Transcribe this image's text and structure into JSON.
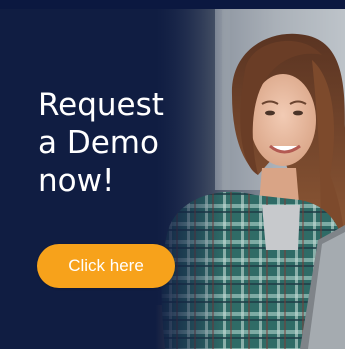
{
  "banner": {
    "headline": {
      "line1": "Request",
      "line2": "a Demo",
      "line3": "now!"
    },
    "cta_label": "Click here",
    "colors": {
      "background": "#101d42",
      "cta": "#f7a21b",
      "text": "#ffffff"
    }
  }
}
